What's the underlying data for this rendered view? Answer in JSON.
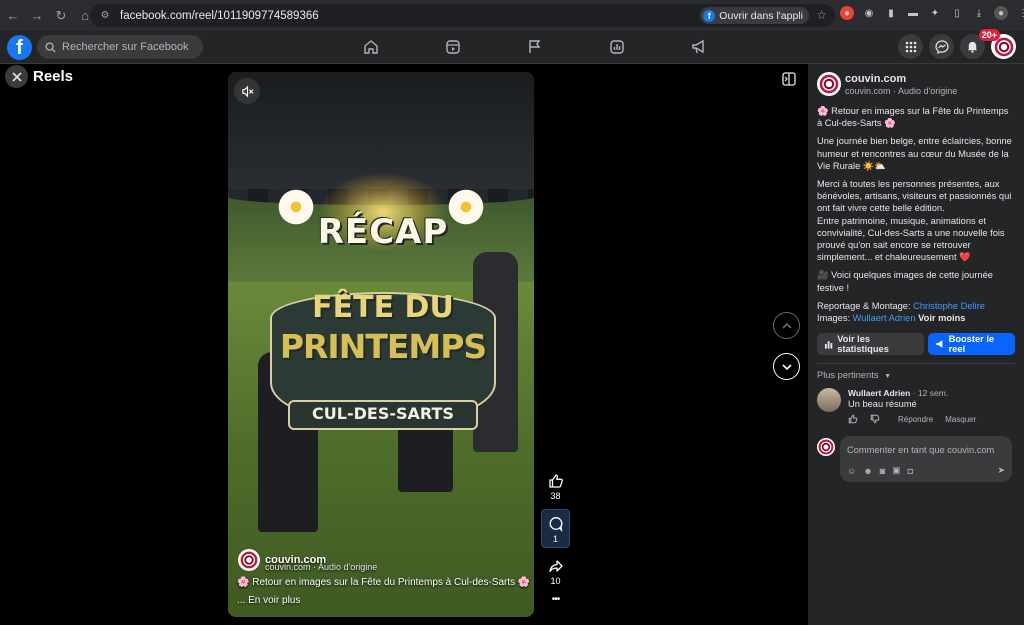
{
  "browser": {
    "url": "facebook.com/reel/1011909774589366",
    "open_app_label": "Ouvrir dans l'appli"
  },
  "fbnav": {
    "logo": "f",
    "search_placeholder": "Rechercher sur Facebook",
    "notif_count": "20+"
  },
  "reels": {
    "title": "Reels"
  },
  "video": {
    "poster_recap": "RÉCAP",
    "poster_fete": "FÊTE DU",
    "poster_printemps": "PRINTEMPS",
    "poster_place": "CUL-DES-SARTS",
    "owner_name": "couvin.com",
    "owner_sub": "couvin.com · Audio d'origine",
    "caption": "🌸 Retour en images sur la Fête du Printemps à Cul-des-Sarts 🌸",
    "more": "... En voir plus"
  },
  "actions": {
    "likes": "38",
    "comments": "1",
    "shares": "10",
    "more": "•••"
  },
  "panel": {
    "owner_name": "couvin.com",
    "owner_sub": "couvin.com · Audio d'origine",
    "p1": "🌸 Retour en images sur la Fête du Printemps à Cul-des-Sarts 🌸",
    "p2": "Une journée bien belge, entre éclaircies, bonne humeur et rencontres au cœur du Musée de la Vie Rurale ☀️⛅",
    "p3_a": "Merci à toutes les personnes présentes, aux bénévoles, artisans, visiteurs et passionnés qui ont fait vivre cette belle édition.",
    "p3_b": "Entre patrimoine, musique, animations et convivialité, Cul-des-Sarts a une nouvelle fois prouvé qu'on sait encore se retrouver simplement... et chaleureusement ❤️",
    "p4": "🎥 Voici quelques images de cette journée festive !",
    "credit_label_1": "Reportage & Montage: ",
    "credit_name_1": "Christophe Delire",
    "credit_label_2": "Images: ",
    "credit_name_2": "Wullaert Adrien",
    "see_less": "Voir moins",
    "stats_button": "Voir les statistiques",
    "boost_button": "Booster le reel",
    "sort_label": "Plus pertinents",
    "comment_author": "Wullaert Adrien",
    "comment_time": "· 12 sem.",
    "comment_text": "Un beau résumé",
    "reply_label": "Répondre",
    "hide_label": "Masquer",
    "compose_placeholder": "Commenter en tant que couvin.com"
  },
  "colors": {
    "fb_blue": "#1877f2",
    "boost_blue": "#0866ff",
    "link_blue": "#4599ff",
    "panel_bg": "#242526",
    "badge_red": "#e41e3f"
  }
}
